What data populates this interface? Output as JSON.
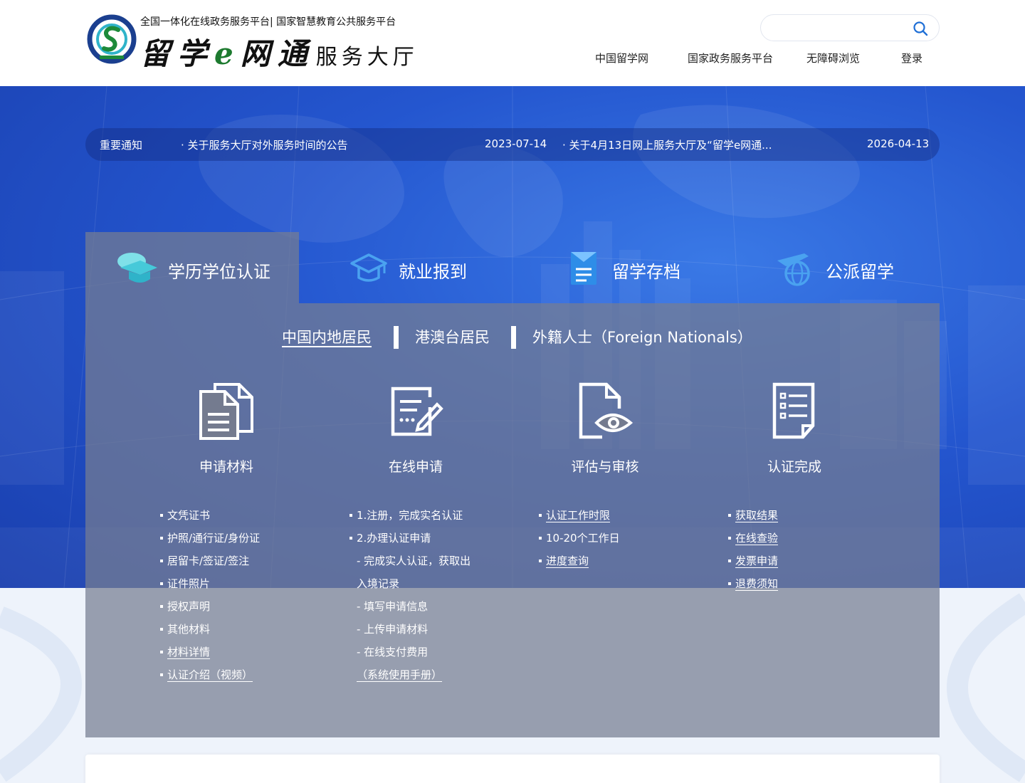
{
  "header": {
    "tagline": "全国一体化在线政务服务平台| 国家智慧教育公共服务平台",
    "brand_script_1": "留学",
    "brand_e": "e",
    "brand_script_2": "网通",
    "brand_sub": "服务大厅",
    "search_placeholder": "",
    "nav": [
      "中国留学网",
      "国家政务服务平台",
      "无障碍浏览",
      "登录"
    ]
  },
  "notice": {
    "label": "重要通知",
    "items": [
      {
        "title": "· 关于服务大厅对外服务时间的公告",
        "date": "2023-07-14"
      },
      {
        "title": "· 关于4月13日网上服务大厅及“留学e网通...",
        "date": "2026-04-13"
      }
    ]
  },
  "tabs": [
    "学历学位认证",
    "就业报到",
    "留学存档",
    "公派留学"
  ],
  "subtabs": [
    "中国内地居民",
    "港澳台居民",
    "外籍人士（Foreign Nationals）"
  ],
  "steps": [
    {
      "title": "申请材料",
      "icon": "documents-icon"
    },
    {
      "title": "在线申请",
      "icon": "edit-form-icon"
    },
    {
      "title": "评估与审核",
      "icon": "review-eye-icon"
    },
    {
      "title": "认证完成",
      "icon": "checklist-icon"
    }
  ],
  "col1": [
    "文凭证书",
    "护照/通行证/身份证",
    "居留卡/签证/签注",
    "证件照片",
    "授权声明",
    "其他材料"
  ],
  "col1_links": [
    "材料详情",
    "认证介绍（视频）"
  ],
  "col2": {
    "step1": "1.注册，完成实名认证",
    "step2": "2.办理认证申请",
    "sub1a": "- 完成实人认证，获取出",
    "sub1b": "入境记录",
    "sub2": "- 填写申请信息",
    "sub3": "- 上传申请材料",
    "sub4": "- 在线支付费用",
    "manual": "（系统使用手册）"
  },
  "col3_links": [
    "认证工作时限",
    "进度查询"
  ],
  "col3_text": "10-20个工作日",
  "col4_links": [
    "获取结果",
    "在线查验",
    "发票申请",
    "退费须知"
  ],
  "colors": {
    "hero": "#2456cf",
    "panel": "rgba(118,125,145,0.72)",
    "accent_cyan": "#46c9d9",
    "accent_blue": "#4aa2f0"
  }
}
